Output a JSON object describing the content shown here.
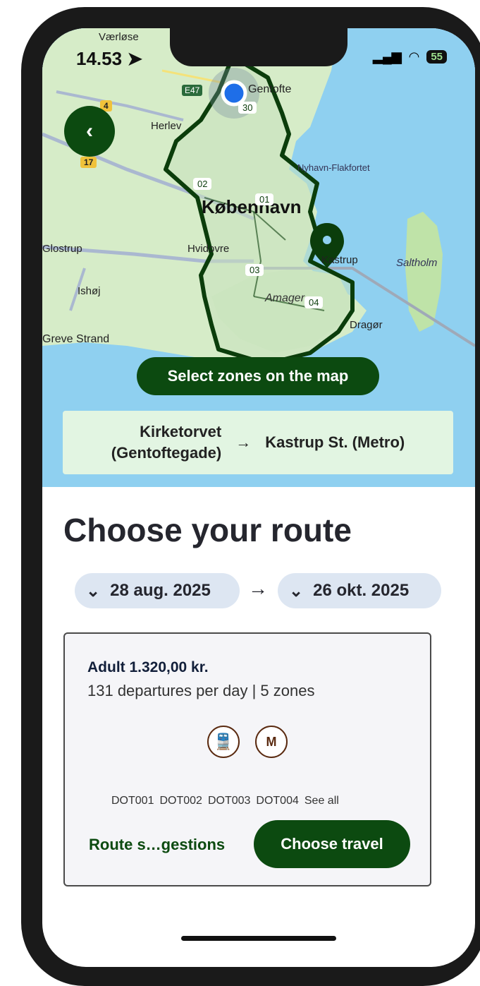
{
  "status": {
    "time": "14.53",
    "battery": "55"
  },
  "map": {
    "places": [
      "Værløse",
      "Gentofte",
      "Herlev",
      "København",
      "Hvidovre",
      "Ishøj",
      "Saltholm",
      "Kastrup",
      "Dragør",
      "Nyhavn-Flakfortet",
      "Greve Strand",
      "Amager",
      "Glostrup"
    ],
    "road_labels": [
      "E47",
      "17",
      "4"
    ],
    "zones": [
      "30",
      "02",
      "01",
      "03",
      "04"
    ],
    "select_label": "Select zones on the map"
  },
  "route": {
    "from_line1": "Kirketorvet",
    "from_line2": "(Gentoftegade)",
    "arrow": "→",
    "to": "Kastrup St. (Metro)"
  },
  "page": {
    "title": "Choose your route"
  },
  "dates": {
    "from": "28 aug. 2025",
    "arrow": "→",
    "to": "26 okt. 2025"
  },
  "card": {
    "price": "Adult 1.320,00 kr.",
    "departures": "131 departures per day | 5 zones",
    "modes": [
      "train-icon",
      "metro-icon"
    ],
    "zone_codes": [
      "DOT001",
      "DOT002",
      "DOT003",
      "DOT004"
    ],
    "see_all": "See all",
    "route_suggestions": "Route s…gestions",
    "choose_travel": "Choose travel"
  },
  "colors": {
    "brand_green": "#0c4a10",
    "map_water": "#8fd0f0",
    "map_land": "#cfe8c0",
    "date_pill": "#dde6f2"
  }
}
